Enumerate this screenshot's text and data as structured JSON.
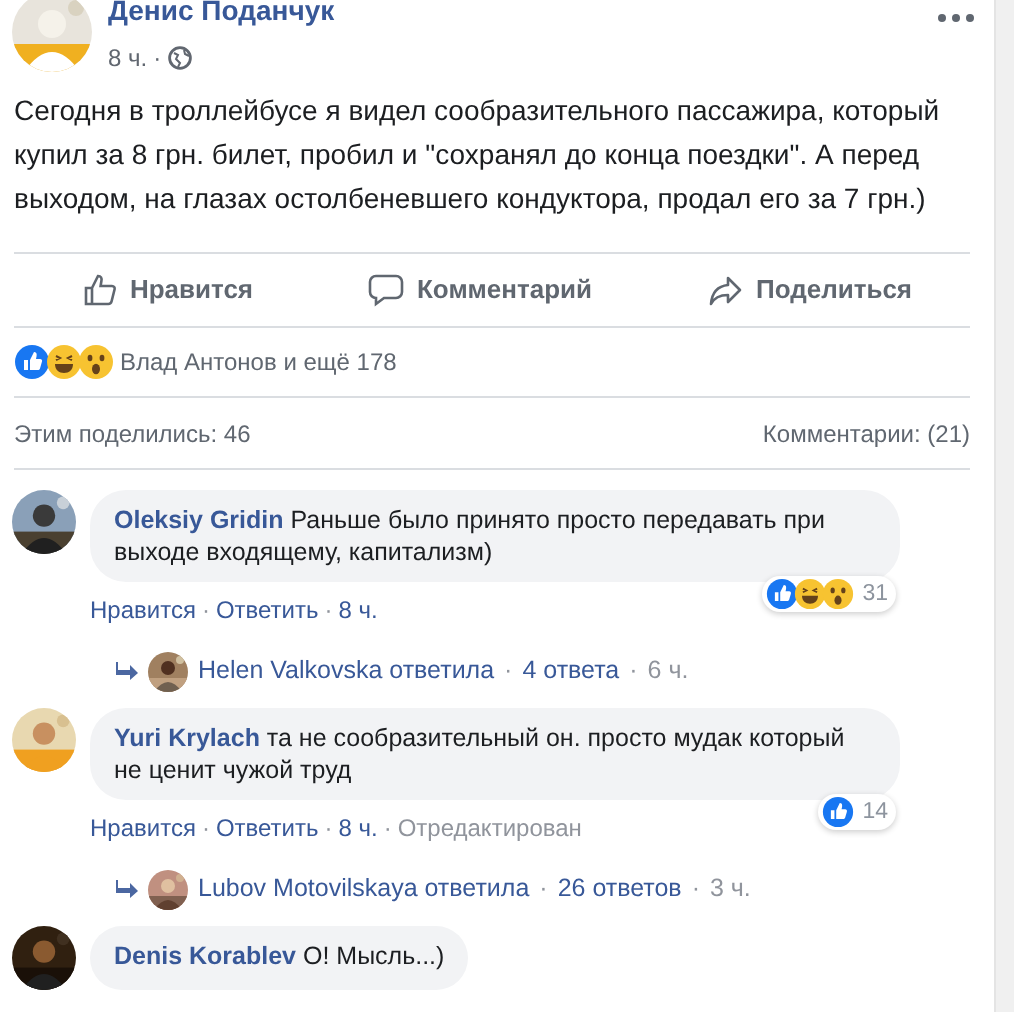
{
  "separator": "·",
  "post": {
    "author": "Денис Поданчук",
    "time": "8 ч.",
    "text": "Сегодня в троллейбусе я видел сообразительного пассажира, который купил за 8 грн. билет, пробил и \"сохранял до конца поездки\". А перед выходом, на глазах остолбеневшего кондуктора, продал его за 7 грн.)"
  },
  "actions": [
    {
      "kind": "like",
      "label": "Нравится"
    },
    {
      "kind": "comment",
      "label": "Комментарий"
    },
    {
      "kind": "share",
      "label": "Поделиться"
    }
  ],
  "reactions": {
    "icons": [
      {
        "kind": "like"
      },
      {
        "kind": "haha"
      },
      {
        "kind": "wow"
      }
    ],
    "text": "Влад Антонов и ещё 178"
  },
  "shares": "Этим поделились: 46",
  "comments_count": "Комментарии: (21)",
  "comments": [
    {
      "author": "Oleksiy Gridin",
      "text": "Раньше было принято просто передавать при выходе входящему, капитализм)",
      "reactions": [
        {
          "kind": "like"
        },
        {
          "kind": "haha"
        },
        {
          "kind": "wow"
        }
      ],
      "reaction_count": "31",
      "meta": [
        {
          "kind": "link",
          "text": "Нравится"
        },
        {
          "kind": "link",
          "text": "Ответить"
        },
        {
          "kind": "link",
          "text": "8 ч."
        }
      ],
      "reply": {
        "text": "Helen Valkovska ответила",
        "count": "4 ответа",
        "time": "6 ч."
      }
    },
    {
      "author": "Yuri Krylach",
      "text": "та не сообразительный он. просто мудак который не ценит чужой труд",
      "reactions": [
        {
          "kind": "like"
        }
      ],
      "reaction_count": "14",
      "meta": [
        {
          "kind": "link",
          "text": "Нравится"
        },
        {
          "kind": "link",
          "text": "Ответить"
        },
        {
          "kind": "link",
          "text": "8 ч."
        },
        {
          "kind": "note",
          "text": "Отредактирован"
        }
      ],
      "reply": {
        "text": "Lubov Motovilskaya ответила",
        "count": "26 ответов",
        "time": "3 ч."
      }
    },
    {
      "author": "Denis Korablev",
      "text": "О! Мысль...)"
    }
  ]
}
